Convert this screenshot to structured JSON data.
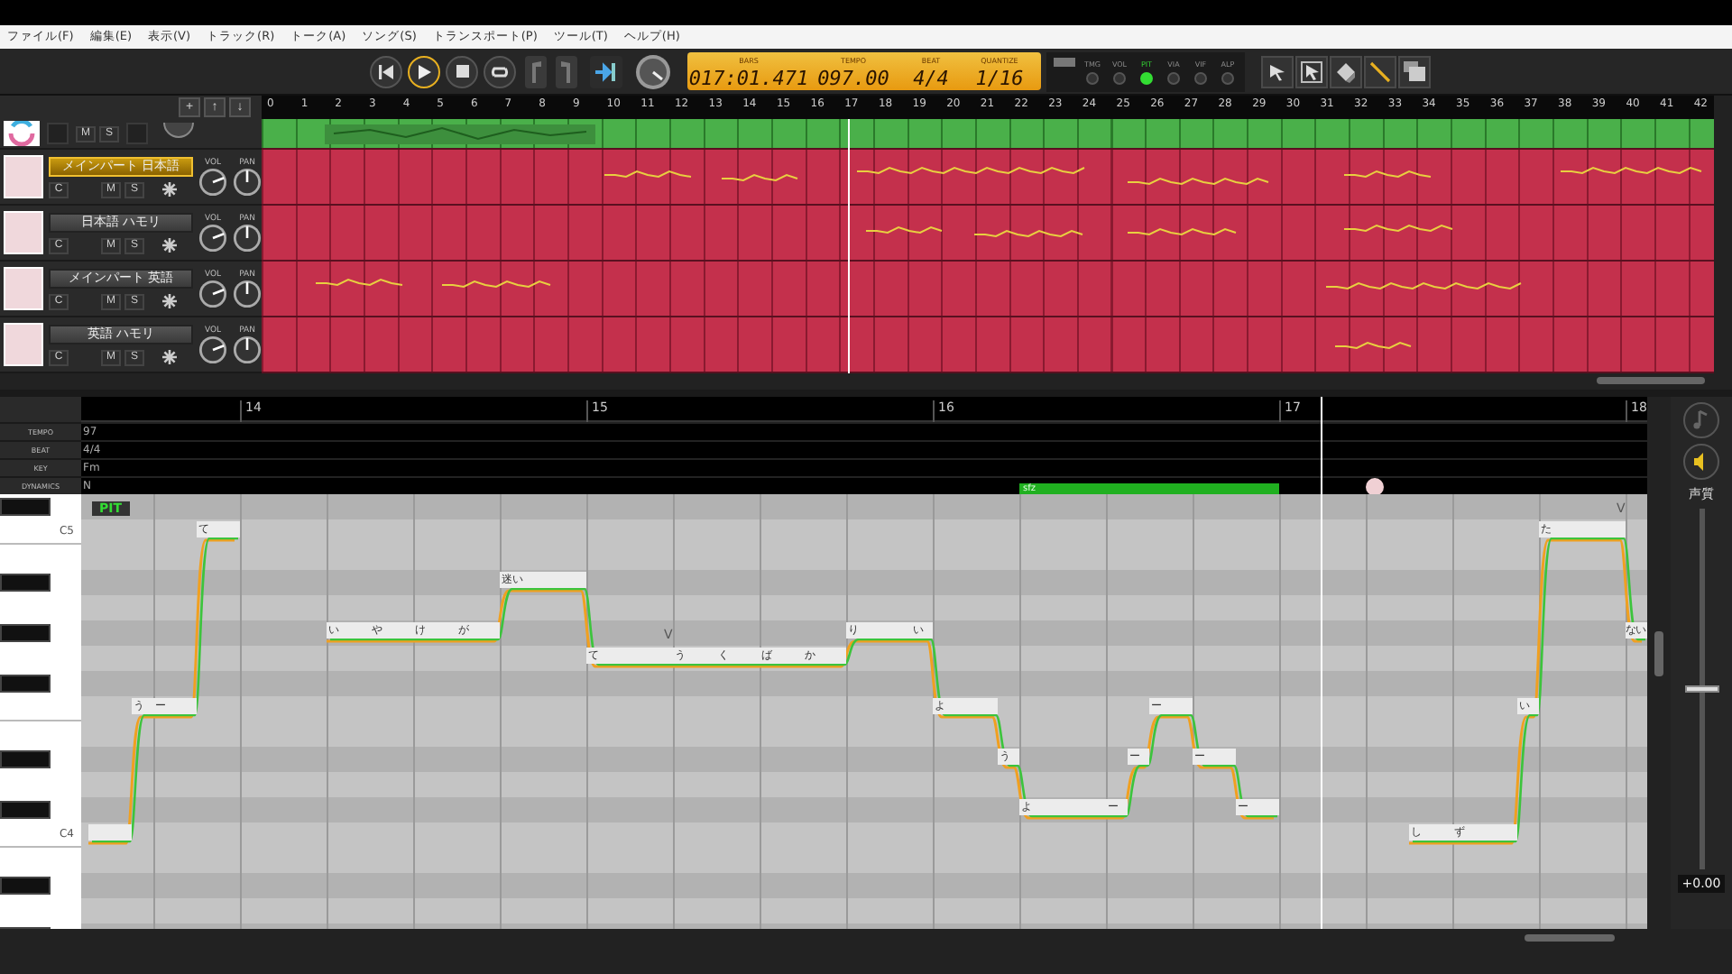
{
  "menu": [
    "ファイル(F)",
    "編集(E)",
    "表示(V)",
    "トラック(R)",
    "トーク(A)",
    "ソング(S)",
    "トランスポート(P)",
    "ツール(T)",
    "ヘルプ(H)"
  ],
  "transport": [
    {
      "kind": "start",
      "on": false
    },
    {
      "kind": "play",
      "on": true
    },
    {
      "kind": "stop",
      "on": false
    },
    {
      "kind": "loop",
      "on": false
    }
  ],
  "edit_buttons": [
    {
      "kind": "mark-in"
    },
    {
      "kind": "mark-out"
    },
    {
      "kind": "follow"
    },
    {
      "kind": "dial"
    }
  ],
  "display": [
    {
      "label": "BARS",
      "value": "017:01.471"
    },
    {
      "label": "TEMPO",
      "value": "097.00"
    },
    {
      "label": "BEAT",
      "value": "4/4"
    },
    {
      "label": "QUANTIZE",
      "value": "1/16"
    }
  ],
  "parameters": [
    {
      "label": "TMG",
      "selected": false
    },
    {
      "label": "VOL",
      "selected": false
    },
    {
      "label": "PIT",
      "selected": true
    },
    {
      "label": "VIA",
      "selected": false
    },
    {
      "label": "VIF",
      "selected": false
    },
    {
      "label": "ALP",
      "selected": false
    }
  ],
  "tools": [
    {
      "kind": "arrow"
    },
    {
      "kind": "select"
    },
    {
      "kind": "eraser"
    },
    {
      "kind": "pencil"
    },
    {
      "kind": "layers"
    }
  ],
  "track_buttons": [
    "+",
    "↑",
    "↓"
  ],
  "track_ruler": [
    "0",
    "1",
    "2",
    "3",
    "4",
    "5",
    "6",
    "7",
    "8",
    "9",
    "10",
    "11",
    "12",
    "13",
    "14",
    "15",
    "16",
    "17",
    "18",
    "19",
    "20",
    "21",
    "22",
    "23",
    "24",
    "25",
    "26",
    "27",
    "28",
    "29",
    "30",
    "31",
    "32",
    "33",
    "34",
    "35",
    "36",
    "37",
    "38",
    "39",
    "40",
    "41",
    "42"
  ],
  "tracks": [
    {
      "kind": "audio",
      "buttons": [
        "M",
        "S"
      ]
    },
    {
      "kind": "voice",
      "name": "メインパート 日本語",
      "selected": true,
      "buttons": [
        "C",
        "M",
        "S"
      ],
      "knobs": [
        "VOL",
        "PAN"
      ]
    },
    {
      "kind": "voice",
      "name": "日本語 ハモリ",
      "selected": false,
      "buttons": [
        "C",
        "M",
        "S"
      ],
      "knobs": [
        "VOL",
        "PAN"
      ]
    },
    {
      "kind": "voice",
      "name": "メインパート 英語",
      "selected": false,
      "buttons": [
        "C",
        "M",
        "S"
      ],
      "knobs": [
        "VOL",
        "PAN"
      ]
    },
    {
      "kind": "voice",
      "name": "英語 ハモリ",
      "selected": false,
      "buttons": [
        "C",
        "M",
        "S"
      ],
      "knobs": [
        "VOL",
        "PAN"
      ]
    }
  ],
  "editor": {
    "ruler": [
      "14",
      "15",
      "16",
      "17",
      "18"
    ],
    "info_rows": [
      {
        "label": "TEMPO",
        "value": "97"
      },
      {
        "label": "BEAT",
        "value": "4/4"
      },
      {
        "label": "KEY",
        "value": "Fm"
      },
      {
        "label": "DYNAMICS",
        "value": "N"
      }
    ],
    "dynamics_region": {
      "label": "sfz"
    },
    "keys": [
      "C5",
      "C4"
    ],
    "mode_badge": "PIT",
    "notes": [
      {
        "lyric": "う"
      },
      {
        "lyric": "ー"
      },
      {
        "lyric": "て"
      },
      {
        "lyric": "い"
      },
      {
        "lyric": "や"
      },
      {
        "lyric": "け"
      },
      {
        "lyric": "が"
      },
      {
        "lyric": "迷い"
      },
      {
        "lyric": "て",
        "mark": "V"
      },
      {
        "lyric": "う"
      },
      {
        "lyric": "く"
      },
      {
        "lyric": "ば"
      },
      {
        "lyric": "か"
      },
      {
        "lyric": "り"
      },
      {
        "lyric": "い"
      },
      {
        "lyric": "よ"
      },
      {
        "lyric": "う"
      },
      {
        "lyric": "よ"
      },
      {
        "lyric": "ー"
      },
      {
        "lyric": "ー"
      },
      {
        "lyric": "ー"
      },
      {
        "lyric": "ー"
      },
      {
        "lyric": "ー"
      },
      {
        "lyric": "し"
      },
      {
        "lyric": "ず"
      },
      {
        "lyric": "い"
      },
      {
        "lyric": "た",
        "mark": "V"
      },
      {
        "lyric": "ない"
      }
    ]
  },
  "side": {
    "label": "声質",
    "level": 0.5,
    "reading": "+0.00"
  }
}
